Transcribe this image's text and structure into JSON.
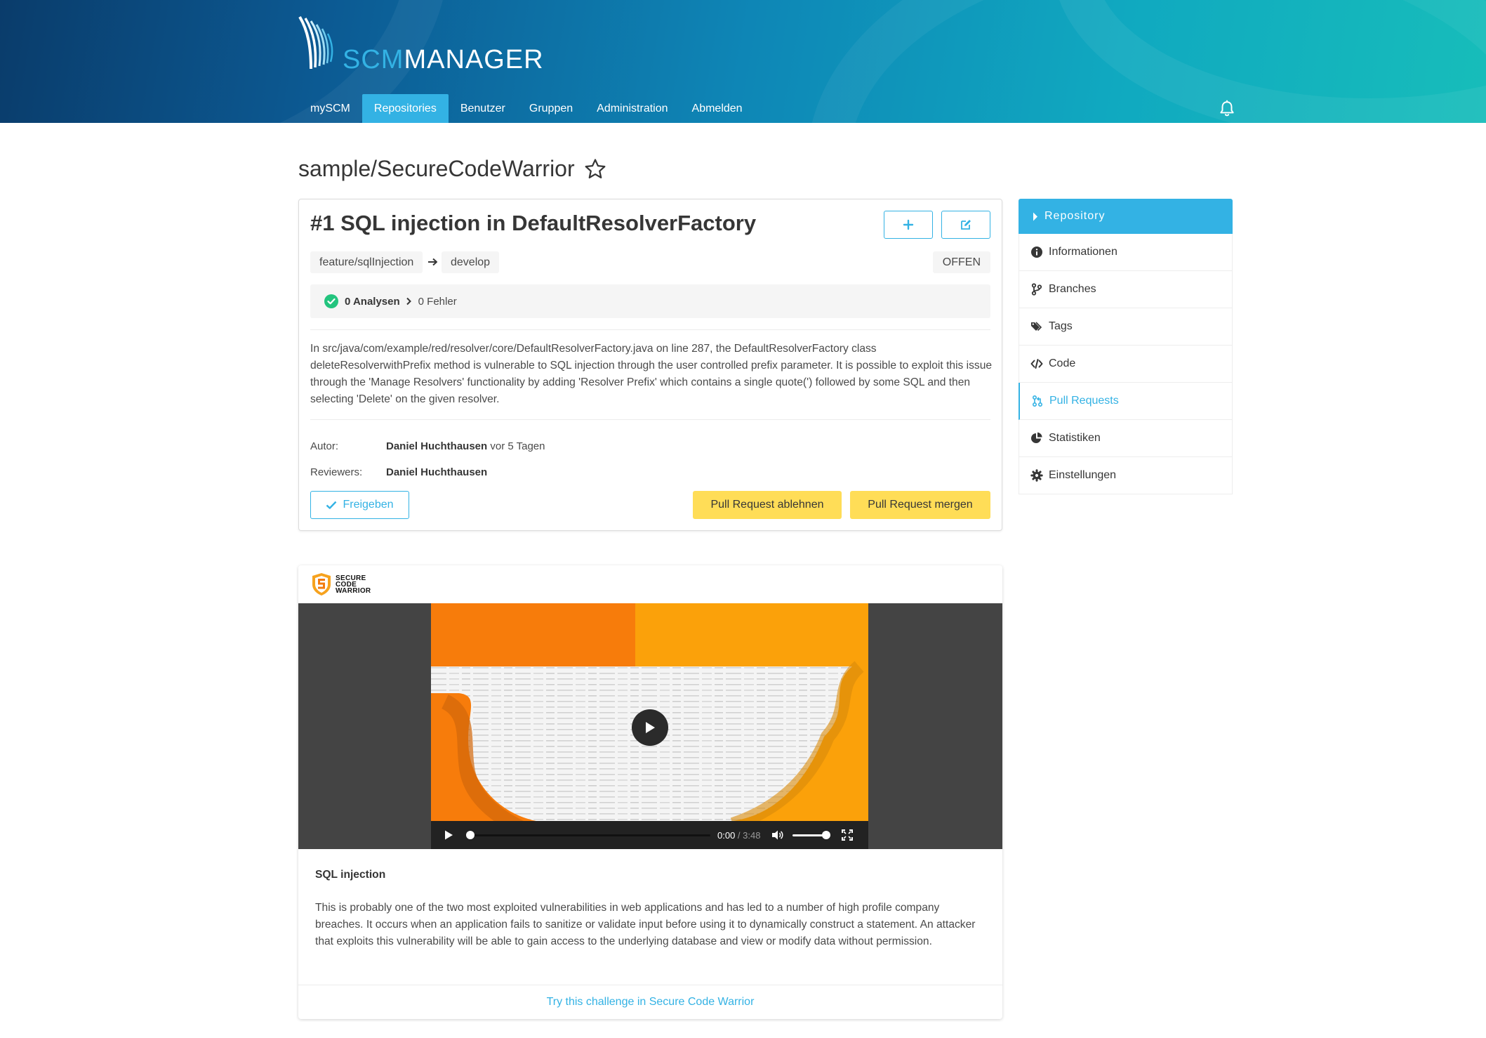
{
  "header": {
    "logo_text_scm": "SCM",
    "logo_text_manager": "MANAGER",
    "nav": [
      "mySCM",
      "Repositories",
      "Benutzer",
      "Gruppen",
      "Administration",
      "Abmelden"
    ],
    "active_nav": "Repositories",
    "bell_icon": "bell-icon"
  },
  "repo": {
    "name": "sample/SecureCodeWarrior",
    "favorite_icon": "star-icon"
  },
  "pull_request": {
    "title": "#1 SQL injection in DefaultResolverFactory",
    "source_branch": "feature/sqlInjection",
    "target_branch": "develop",
    "status": "OFFEN",
    "analysis_count": "0 Analysen",
    "analysis_errors": "0 Fehler",
    "description": "In src/java/com/example/red/resolver/core/DefaultResolverFactory.java on line 287, the DefaultResolverFactory class deleteResolverwithPrefix method is vulnerable to SQL injection through the user controlled prefix parameter. It is possible to exploit this issue through the 'Manage Resolvers' functionality by adding 'Resolver Prefix' which contains a single quote(') followed by some SQL and then selecting 'Delete' on the given resolver.",
    "author_label": "Autor:",
    "author_name": "Daniel Huchthausen",
    "author_time": " vor 5 Tagen",
    "reviewers_label": "Reviewers:",
    "reviewer_name": "Daniel Huchthausen",
    "approve_label": "Freigeben",
    "reject_label": "Pull Request ablehnen",
    "merge_label": "Pull Request mergen",
    "accent_color": "#33b2e4",
    "warning_color": "#ffdd57"
  },
  "sidebar": {
    "heading": "Repository",
    "items": [
      {
        "label": "Informationen",
        "icon": "info-circle-icon"
      },
      {
        "label": "Branches",
        "icon": "code-branch-icon"
      },
      {
        "label": "Tags",
        "icon": "tags-icon"
      },
      {
        "label": "Code",
        "icon": "code-icon"
      },
      {
        "label": "Pull Requests",
        "icon": "pull-request-icon"
      },
      {
        "label": "Statistiken",
        "icon": "chart-pie-icon"
      },
      {
        "label": "Einstellungen",
        "icon": "cog-icon"
      }
    ],
    "active_item": "Pull Requests"
  },
  "scw": {
    "logo_lines": [
      "SECURE",
      "CODE",
      "WARRIOR"
    ],
    "video_current_time": "0:00",
    "video_duration": "3:48",
    "video_progress": 0,
    "volume_level": 1.0,
    "heading": "SQL injection",
    "text": "This is probably one of the two most exploited vulnerabilities in web applications and has led to a number of high profile company breaches. It occurs when an application fails to sanitize or validate input before using it to dynamically construct a statement. An attacker that exploits this vulnerability will be able to gain access to the underlying database and view or modify data without permission.",
    "link": "Try this challenge in Secure Code Warrior"
  }
}
